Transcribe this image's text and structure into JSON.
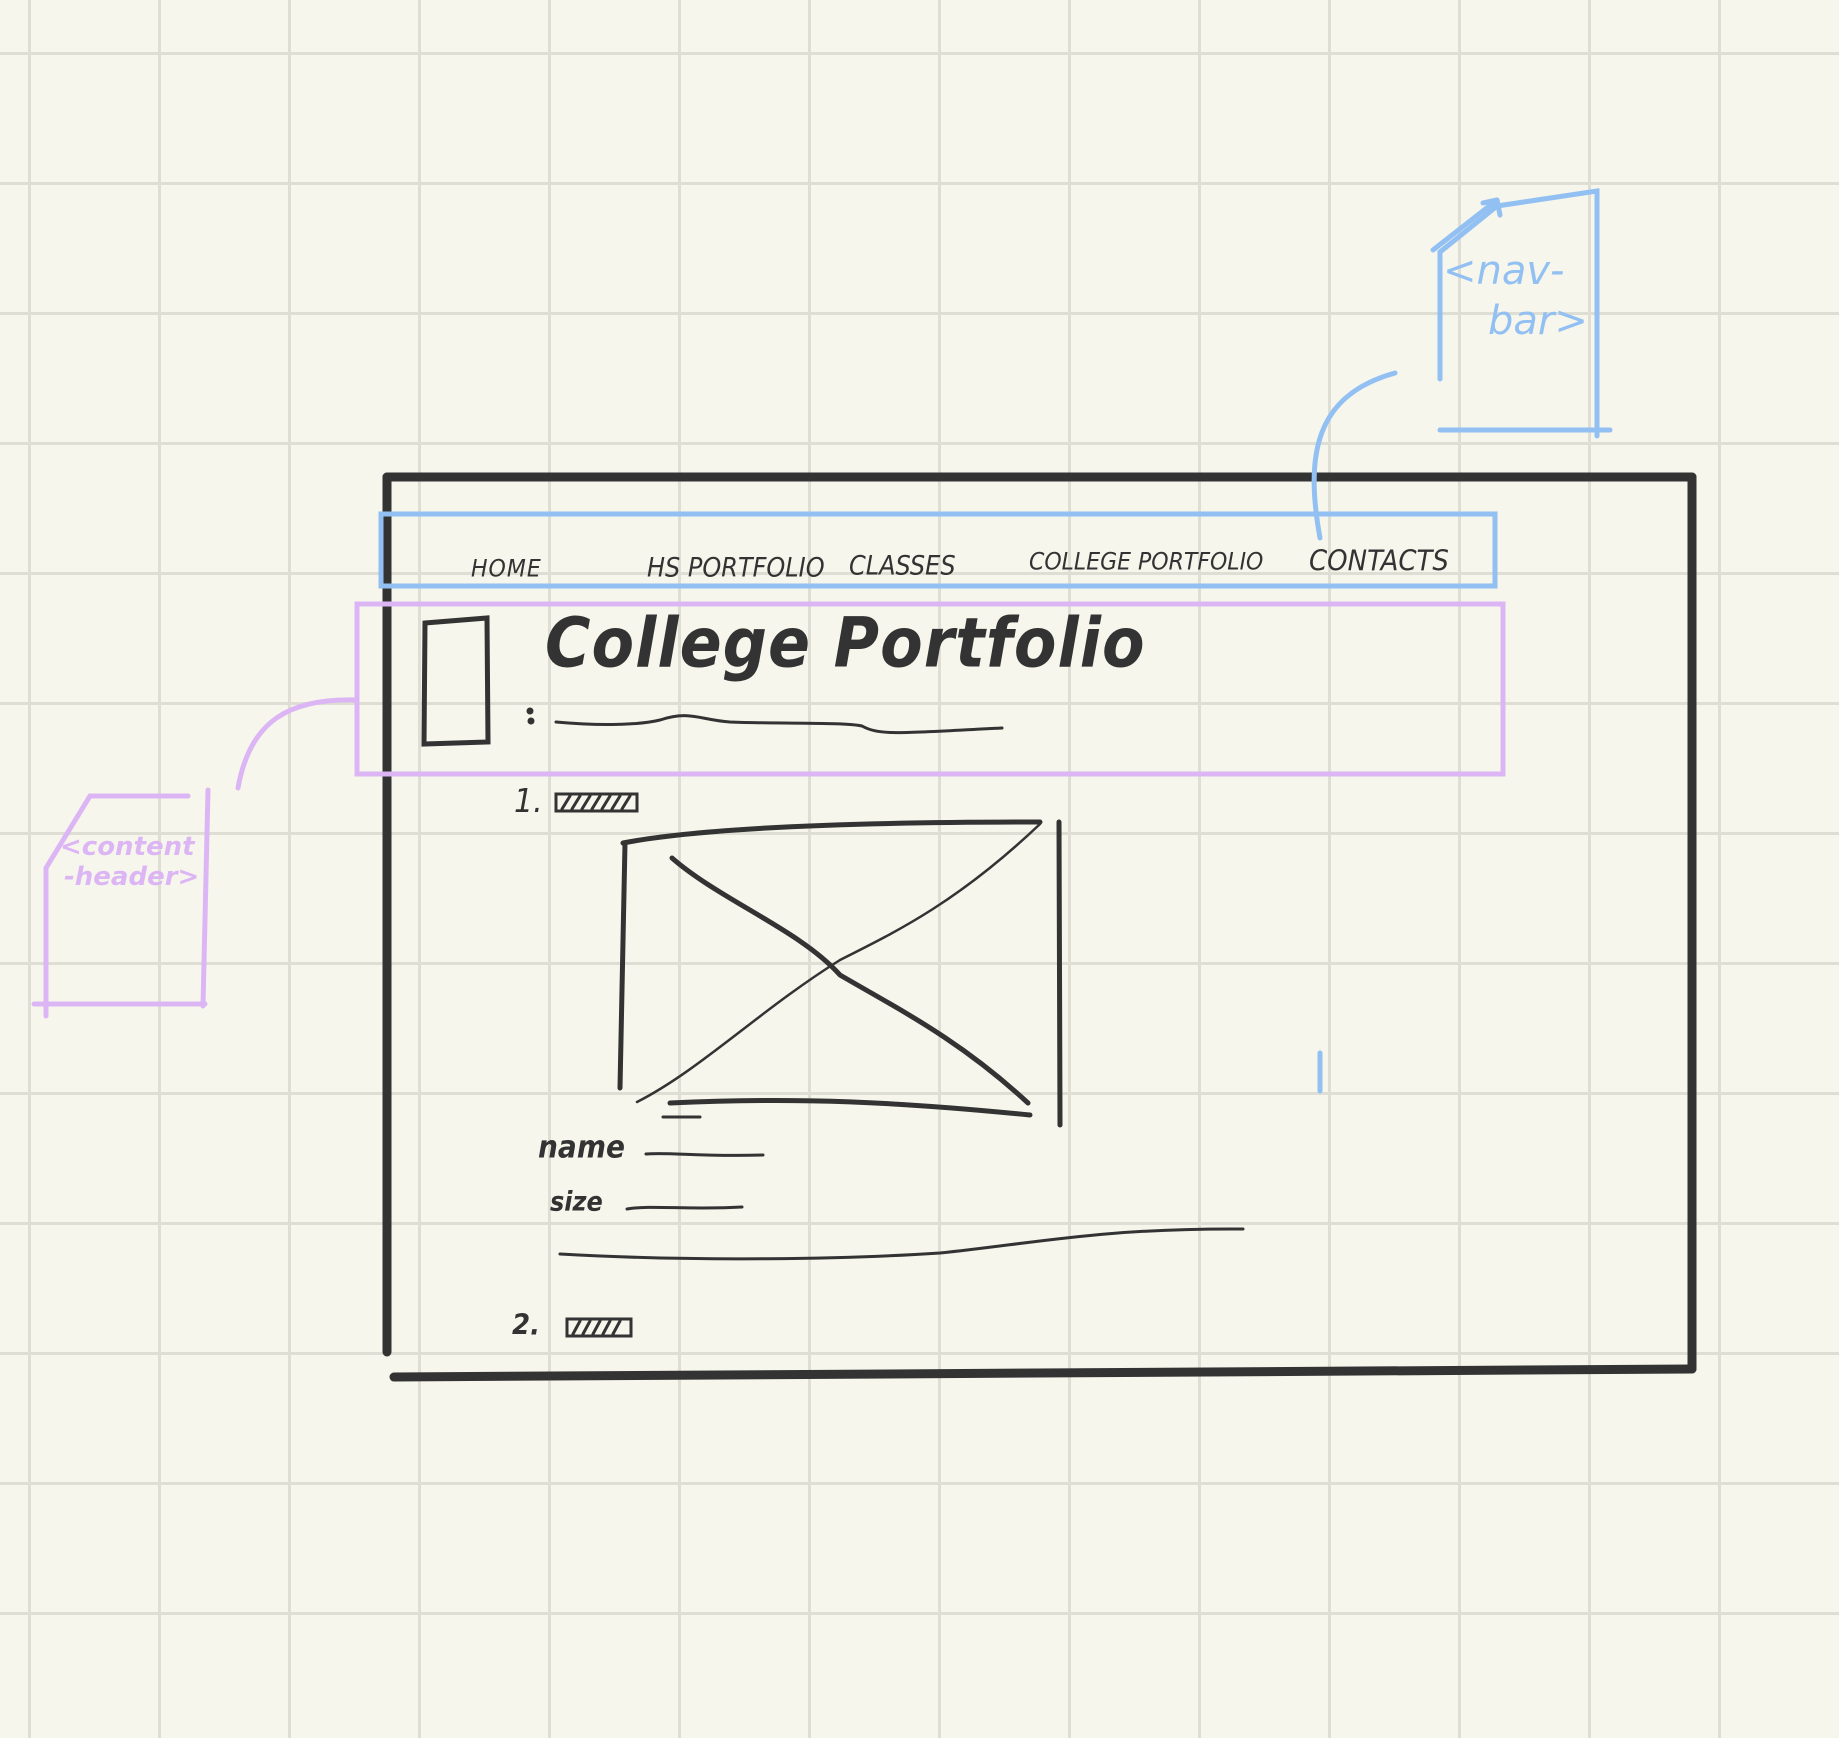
{
  "colors": {
    "background": "#f6f6ec",
    "grid": "#deded4",
    "ink": "#333333",
    "navbar_annotation": "#92c0f2",
    "content_header_annotation": "#dcb6f4"
  },
  "annotations": {
    "navbar_label_line1": "<nav-",
    "navbar_label_line2": "bar>",
    "content_header_label_line1": "<content",
    "content_header_label_line2": "-header>"
  },
  "navbar": {
    "items": [
      {
        "label": "HOME"
      },
      {
        "label": "HS PORTFOLIO"
      },
      {
        "label": "CLASSES"
      },
      {
        "label": "COLLEGE PORTFOLIO"
      },
      {
        "label": "CONTACTS"
      }
    ]
  },
  "content_header": {
    "title": "College Portfolio"
  },
  "sections": [
    {
      "number": "1.",
      "name_label": "name",
      "size_label": "size"
    },
    {
      "number": "2."
    }
  ],
  "icons": {
    "image_placeholder": "image-placeholder-icon",
    "header_image": "header-image-placeholder-icon"
  }
}
